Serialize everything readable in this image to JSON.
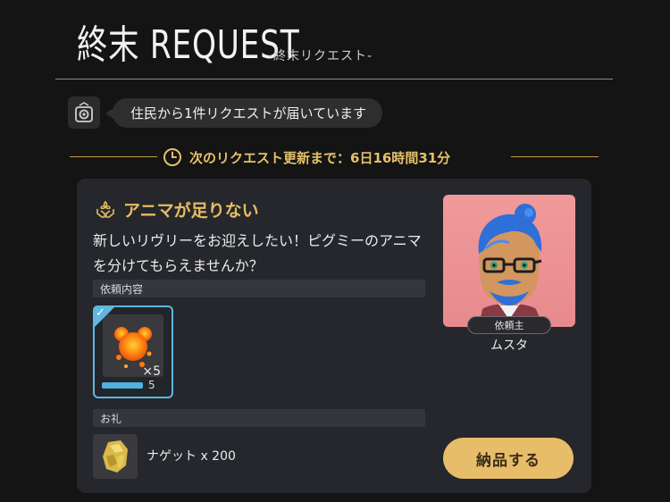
{
  "header": {
    "title": "終末 REQUEST",
    "subtitle": "-終末リクエスト-"
  },
  "notice": {
    "icon": "resident-request-icon",
    "text": "住民から1件リクエストが届いています"
  },
  "timer": {
    "icon": "clock-icon",
    "text": "次のリクエスト更新まで：6日16時間31分",
    "accent_color": "#e5c06a"
  },
  "request": {
    "title": "アニマが足りない",
    "title_icon": "anima-hands-icon",
    "description": "新しいリヴリーをお迎えしたい！ピグミーのアニマを分けてもらえませんか？",
    "content_section_label": "依頼内容",
    "item": {
      "icon": "anima-orb-icon",
      "required_qty": "×5",
      "owned_qty": "5",
      "progress_fraction": 1.0,
      "selected": true
    },
    "reward_section_label": "お礼",
    "reward": {
      "icon": "nugget-icon",
      "text": "ナゲット x 200"
    },
    "requester": {
      "tag": "依頼主",
      "name": "ムスタ",
      "portrait": "requester-portrait"
    },
    "deliver_button": "納品する",
    "button_color": "#e8bd6a"
  }
}
